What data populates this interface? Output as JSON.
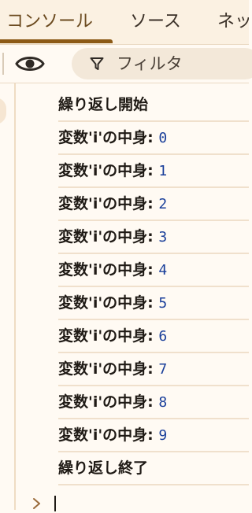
{
  "tabs": [
    {
      "label": "コンソール",
      "active": true
    },
    {
      "label": "ソース",
      "active": false
    },
    {
      "label": "ネッ",
      "active": false
    }
  ],
  "toolbar": {
    "eye_icon": "eye-icon",
    "filter_icon": "funnel-icon",
    "filter_placeholder": "フィルタ"
  },
  "console": {
    "messages": [
      {
        "text": "繰り返し開始"
      },
      {
        "text": "変数'i'の中身:",
        "value": "0"
      },
      {
        "text": "変数'i'の中身:",
        "value": "1"
      },
      {
        "text": "変数'i'の中身:",
        "value": "2"
      },
      {
        "text": "変数'i'の中身:",
        "value": "3"
      },
      {
        "text": "変数'i'の中身:",
        "value": "4"
      },
      {
        "text": "変数'i'の中身:",
        "value": "5"
      },
      {
        "text": "変数'i'の中身:",
        "value": "6"
      },
      {
        "text": "変数'i'の中身:",
        "value": "7"
      },
      {
        "text": "変数'i'の中身:",
        "value": "8"
      },
      {
        "text": "変数'i'の中身:",
        "value": "9"
      },
      {
        "text": "繰り返し終了"
      }
    ],
    "prompt_icon": "chevron-right-icon"
  },
  "colors": {
    "accent": "#8c5a16",
    "number": "#1a3f9a",
    "background": "#fffaf3"
  }
}
